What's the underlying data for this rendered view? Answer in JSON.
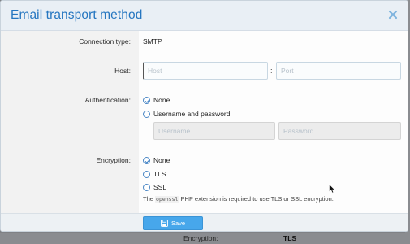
{
  "background": {
    "encryption_label": "Encryption:",
    "encryption_value": "TLS"
  },
  "dialog": {
    "title": "Email transport method",
    "close_icon": "close-icon"
  },
  "connection": {
    "label": "Connection type:",
    "value": "SMTP"
  },
  "host": {
    "label": "Host:",
    "host_placeholder": "Host",
    "host_value": "",
    "separator": ":",
    "port_placeholder": "Port",
    "port_value": ""
  },
  "authentication": {
    "label": "Authentication:",
    "options": [
      {
        "label": "None",
        "selected": true
      },
      {
        "label": "Username and password",
        "selected": false
      }
    ],
    "username_placeholder": "Username",
    "password_placeholder": "Password"
  },
  "encryption": {
    "label": "Encryption:",
    "options": [
      {
        "label": "None",
        "selected": true
      },
      {
        "label": "TLS",
        "selected": false
      },
      {
        "label": "SSL",
        "selected": false
      }
    ],
    "help_prefix": "The",
    "help_code": "openssl",
    "help_suffix": "PHP extension is required to use TLS or SSL encryption."
  },
  "footer": {
    "save_label": "Save",
    "save_icon": "save-icon"
  },
  "colors": {
    "accent": "#2576c0",
    "button": "#47a7eb",
    "header_bg": "#e9eff5"
  }
}
